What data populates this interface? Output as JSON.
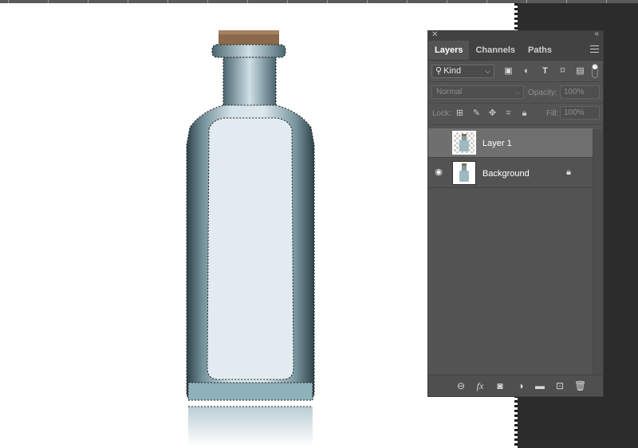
{
  "panel": {
    "tabs": [
      {
        "label": "Layers",
        "active": true
      },
      {
        "label": "Channels",
        "active": false
      },
      {
        "label": "Paths",
        "active": false
      }
    ],
    "filter": {
      "kind_label": "Kind",
      "filter_icons": [
        "image-filter-icon",
        "adjustment-filter-icon",
        "type-filter-icon",
        "shape-filter-icon",
        "smart-object-filter-icon"
      ]
    },
    "blend_mode": "Normal",
    "opacity_label": "Opacity:",
    "opacity_value": "100%",
    "lock_label": "Lock:",
    "lock_icons": [
      "lock-transparent-pixels-icon",
      "lock-image-pixels-icon",
      "lock-position-icon",
      "lock-artboard-icon",
      "lock-all-icon"
    ],
    "fill_label": "Fill:",
    "fill_value": "100%",
    "layers": [
      {
        "name": "Layer 1",
        "visible": false,
        "selected": true,
        "locked": false
      },
      {
        "name": "Background",
        "visible": true,
        "selected": false,
        "locked": true
      }
    ],
    "footer_icons": [
      "link-layers-icon",
      "fx-icon",
      "add-mask-icon",
      "adjustment-layer-icon",
      "group-folder-icon",
      "new-layer-icon",
      "trash-icon"
    ],
    "colors": {
      "panel_bg": "#535353",
      "tab_bar_bg": "#424242",
      "selected_layer_bg": "#6f6f6f",
      "pasteboard": "#2c2c2c"
    }
  }
}
